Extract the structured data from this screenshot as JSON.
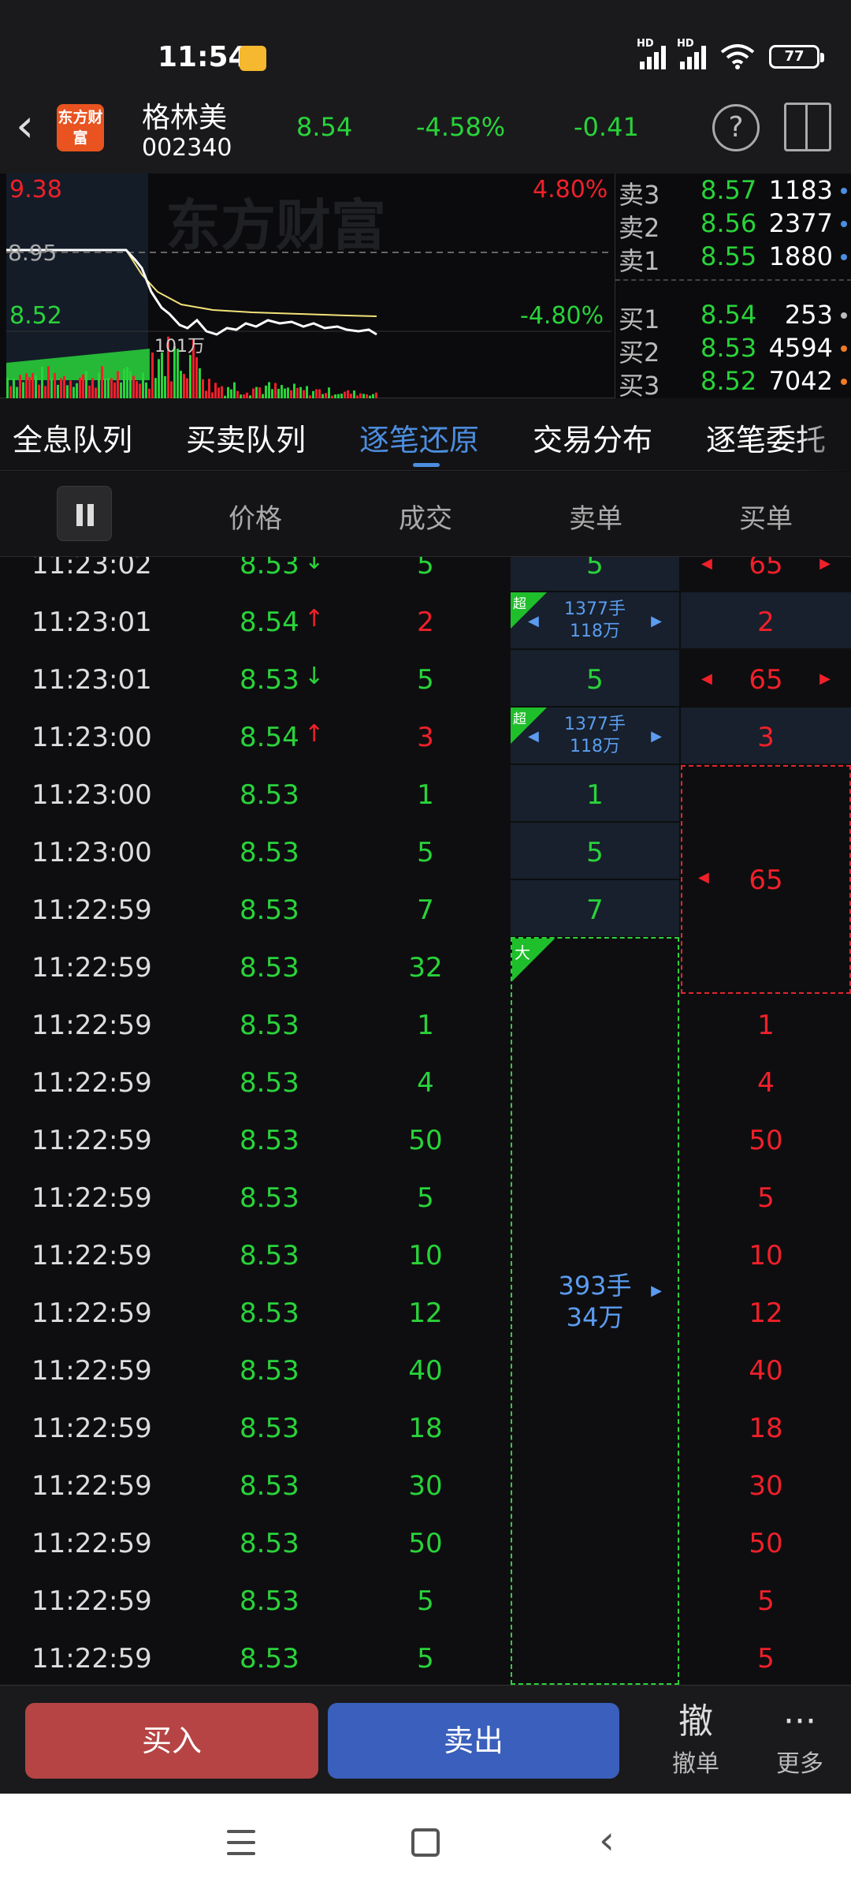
{
  "status": {
    "time": "11:54",
    "battery": "77",
    "hd1": "HD",
    "hd2": "HD"
  },
  "header": {
    "back_icon": "chevron-left-icon",
    "logo_text": "东方财富",
    "stock_name": "格林美",
    "stock_code": "002340",
    "price": "8.54",
    "change_pct": "-4.58%",
    "change_abs": "-0.41",
    "help_label": "?"
  },
  "chart": {
    "high_price": "9.38",
    "high_pct": "4.80%",
    "ref_price": "8.95",
    "low_price": "8.52",
    "low_pct": "-4.80%",
    "volume_label": "101万",
    "watermark": "东方财富",
    "colors": {
      "price_line": "#ffffff",
      "avg_line": "#f2e27a",
      "up": "#f0202a",
      "down": "#29d33a"
    }
  },
  "orderbook": {
    "asks": [
      {
        "label": "卖3",
        "price": "8.57",
        "vol": "1183",
        "dot": "#4c8ee0"
      },
      {
        "label": "卖2",
        "price": "8.56",
        "vol": "2377",
        "dot": "#4c8ee0"
      },
      {
        "label": "卖1",
        "price": "8.55",
        "vol": "1880",
        "dot": "#4c8ee0"
      }
    ],
    "bids": [
      {
        "label": "买1",
        "price": "8.54",
        "vol": "253",
        "dot": "#bbbbbb"
      },
      {
        "label": "买2",
        "price": "8.53",
        "vol": "4594",
        "dot": "#f07a26"
      },
      {
        "label": "买3",
        "price": "8.52",
        "vol": "7042",
        "dot": "#f07a26"
      }
    ]
  },
  "tabs": [
    {
      "label": "全息队列",
      "active": false
    },
    {
      "label": "买卖队列",
      "active": false
    },
    {
      "label": "逐笔还原",
      "active": true
    },
    {
      "label": "交易分布",
      "active": false
    },
    {
      "label": "逐笔委托",
      "active": false
    }
  ],
  "columns": {
    "price": "价格",
    "volume": "成交",
    "sell": "卖单",
    "buy": "买单"
  },
  "ticks": [
    {
      "time": "11:23:02",
      "price": "8.53",
      "dir": "down",
      "vol": "5",
      "vol_color": "green",
      "sell": "5",
      "buy": "65",
      "buy_arrows": true
    },
    {
      "time": "11:23:01",
      "price": "8.54",
      "dir": "up",
      "vol": "2",
      "vol_color": "red",
      "sell_badge": "超",
      "sell_line1": "1377手",
      "sell_line2": "118万",
      "buy": "2"
    },
    {
      "time": "11:23:01",
      "price": "8.53",
      "dir": "down",
      "vol": "5",
      "vol_color": "green",
      "sell": "5",
      "buy": "65",
      "buy_arrows": true
    },
    {
      "time": "11:23:00",
      "price": "8.54",
      "dir": "up",
      "vol": "3",
      "vol_color": "red",
      "sell_badge": "超",
      "sell_line1": "1377手",
      "sell_line2": "118万",
      "buy": "3"
    },
    {
      "time": "11:23:00",
      "price": "8.53",
      "dir": "",
      "vol": "1",
      "vol_color": "green",
      "sell": "1"
    },
    {
      "time": "11:23:00",
      "price": "8.53",
      "dir": "",
      "vol": "5",
      "vol_color": "green",
      "sell": "5"
    },
    {
      "time": "11:22:59",
      "price": "8.53",
      "dir": "",
      "vol": "7",
      "vol_color": "green",
      "sell": "7"
    },
    {
      "time": "11:22:59",
      "price": "8.53",
      "dir": "",
      "vol": "32",
      "vol_color": "green"
    },
    {
      "time": "11:22:59",
      "price": "8.53",
      "dir": "",
      "vol": "1",
      "vol_color": "green",
      "buy_plain": "1"
    },
    {
      "time": "11:22:59",
      "price": "8.53",
      "dir": "",
      "vol": "4",
      "vol_color": "green",
      "buy_plain": "4"
    },
    {
      "time": "11:22:59",
      "price": "8.53",
      "dir": "",
      "vol": "50",
      "vol_color": "green",
      "buy_plain": "50"
    },
    {
      "time": "11:22:59",
      "price": "8.53",
      "dir": "",
      "vol": "5",
      "vol_color": "green",
      "buy_plain": "5"
    },
    {
      "time": "11:22:59",
      "price": "8.53",
      "dir": "",
      "vol": "10",
      "vol_color": "green",
      "buy_plain": "10"
    },
    {
      "time": "11:22:59",
      "price": "8.53",
      "dir": "",
      "vol": "12",
      "vol_color": "green",
      "buy_plain": "12"
    },
    {
      "time": "11:22:59",
      "price": "8.53",
      "dir": "",
      "vol": "40",
      "vol_color": "green",
      "buy_plain": "40"
    },
    {
      "time": "11:22:59",
      "price": "8.53",
      "dir": "",
      "vol": "18",
      "vol_color": "green",
      "buy_plain": "18"
    },
    {
      "time": "11:22:59",
      "price": "8.53",
      "dir": "",
      "vol": "30",
      "vol_color": "green",
      "buy_plain": "30"
    },
    {
      "time": "11:22:59",
      "price": "8.53",
      "dir": "",
      "vol": "50",
      "vol_color": "green",
      "buy_plain": "50"
    },
    {
      "time": "11:22:59",
      "price": "8.53",
      "dir": "",
      "vol": "5",
      "vol_color": "green",
      "buy_plain": "5"
    },
    {
      "time": "11:22:59",
      "price": "8.53",
      "dir": "",
      "vol": "5",
      "vol_color": "green",
      "buy_plain": "5"
    }
  ],
  "merged": {
    "buy_65": "65",
    "big_sell_badge": "大",
    "big_sell_line1": "393手",
    "big_sell_line2": "34万"
  },
  "bottom": {
    "buy_label": "买入",
    "sell_label": "卖出",
    "cancel_icon": "撤",
    "cancel_label": "撤单",
    "more_icon": "···",
    "more_label": "更多"
  }
}
